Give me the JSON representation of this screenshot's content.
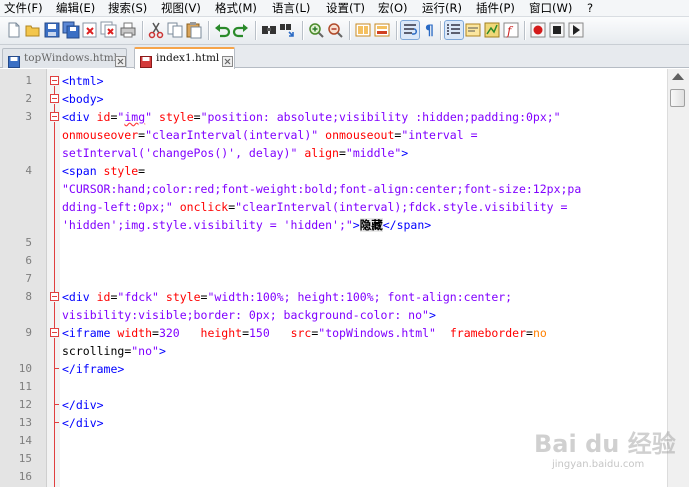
{
  "menu": [
    "文件(F)",
    "编辑(E)",
    "搜索(S)",
    "视图(V)",
    "格式(M)",
    "语言(L)",
    "设置(T)",
    "宏(O)",
    "运行(R)",
    "插件(P)",
    "窗口(W)",
    "?"
  ],
  "toolbar": {
    "icons": [
      "new-file-icon",
      "open-file-icon",
      "save-icon",
      "save-all-icon",
      "close-icon",
      "close-all-icon",
      "print-icon",
      "cut-icon",
      "copy-icon",
      "paste-icon",
      "undo-icon",
      "redo-icon",
      "find-icon",
      "replace-icon",
      "zoom-in-icon",
      "zoom-out-icon",
      "sync-vertical-icon",
      "sync-horizontal-icon",
      "word-wrap-icon",
      "show-all-chars-icon",
      "indent-guide-icon",
      "user-define-language-icon",
      "doc-map-icon",
      "function-list-icon",
      "record-macro-icon",
      "stop-record-icon",
      "play-macro-icon"
    ]
  },
  "tabs": [
    {
      "label": "topWindows.html",
      "active": false
    },
    {
      "label": "index1.html",
      "active": true
    }
  ],
  "lines": [
    {
      "num": "1"
    },
    {
      "num": "2"
    },
    {
      "num": "3"
    },
    {
      "num": ""
    },
    {
      "num": ""
    },
    {
      "num": "4"
    },
    {
      "num": ""
    },
    {
      "num": ""
    },
    {
      "num": ""
    },
    {
      "num": "5"
    },
    {
      "num": "6"
    },
    {
      "num": "7"
    },
    {
      "num": "8"
    },
    {
      "num": ""
    },
    {
      "num": "9"
    },
    {
      "num": ""
    },
    {
      "num": "10"
    },
    {
      "num": "11"
    },
    {
      "num": "12"
    },
    {
      "num": "13"
    },
    {
      "num": "14"
    },
    {
      "num": "15"
    },
    {
      "num": "16"
    }
  ],
  "code": {
    "l1": {
      "tag": "<html>"
    },
    "l2": {
      "tag": "<body>"
    },
    "l3a": {
      "p1": "<div ",
      "a1": "id",
      "e1": "=",
      "v1": "\"img\"",
      "sp1": " ",
      "a2": "style",
      "e2": "=",
      "v2": "\"position: absolute;visibility :hidden;padding:0px;\""
    },
    "l3b": {
      "a1": "onmouseover",
      "e1": "=",
      "v1": "\"clearInterval(interval)\"",
      "sp1": " ",
      "a2": "onmouseout",
      "e2": "=",
      "v2": "\"interval ="
    },
    "l3c": {
      "v1": "setInterval('changePos()', delay)\"",
      "sp1": " ",
      "a1": "align",
      "e1": "=",
      "v2": "\"middle\"",
      "t1": ">"
    },
    "l4a": {
      "p1": "<span ",
      "a1": "style",
      "e1": "="
    },
    "l4b": {
      "v1": "\"CURSOR:hand;color:red;font-weight:bold;font-align:center;font-size:12px;pa"
    },
    "l4c": {
      "v1": "dding-left:0px;\"",
      "sp1": " ",
      "a1": "onclick",
      "e1": "=",
      "v2": "\"clearInterval(interval);fdck.style.visibility ="
    },
    "l4d": {
      "v1": "'hidden';img.style.visibility = 'hidden';\"",
      "t1": ">",
      "s1": "隐藏",
      "t2": "</span>"
    },
    "l8a": {
      "p1": "<div ",
      "a1": "id",
      "e1": "=",
      "v1": "\"fdck\"",
      "sp1": " ",
      "a2": "style",
      "e2": "=",
      "v2": "\"width:100%; height:100%; font-align:center;"
    },
    "l8b": {
      "v1": "visibility:visible;border: 0px; background-color: no\"",
      "t1": ">"
    },
    "l9a": {
      "p1": "<iframe ",
      "a1": "width",
      "e1": "=",
      "n1": "320",
      "sp1": "   ",
      "a2": "height",
      "e2": "=",
      "n2": "150",
      "sp2": "   ",
      "a3": "src",
      "e3": "=",
      "v1": "\"topWindows.html\"",
      "sp3": "  ",
      "a4": "frameborder",
      "e4": "=",
      "n3": "no"
    },
    "l9b": {
      "a1": "scrolling",
      "e1": "=",
      "v1": "\"no\"",
      "t1": ">"
    },
    "l10": {
      "tag": "</iframe>"
    },
    "l12": {
      "tag": "</div>"
    },
    "l13": {
      "tag": "</div>"
    }
  },
  "watermark": {
    "text": "Bai du 经验",
    "sub": "jingyan.baidu.com"
  },
  "colors": {
    "tag": "#0000ff",
    "attr": "#ff0000",
    "value": "#8000ff",
    "fold": "#e04040",
    "active_tab_accent": "#f6a44a"
  }
}
